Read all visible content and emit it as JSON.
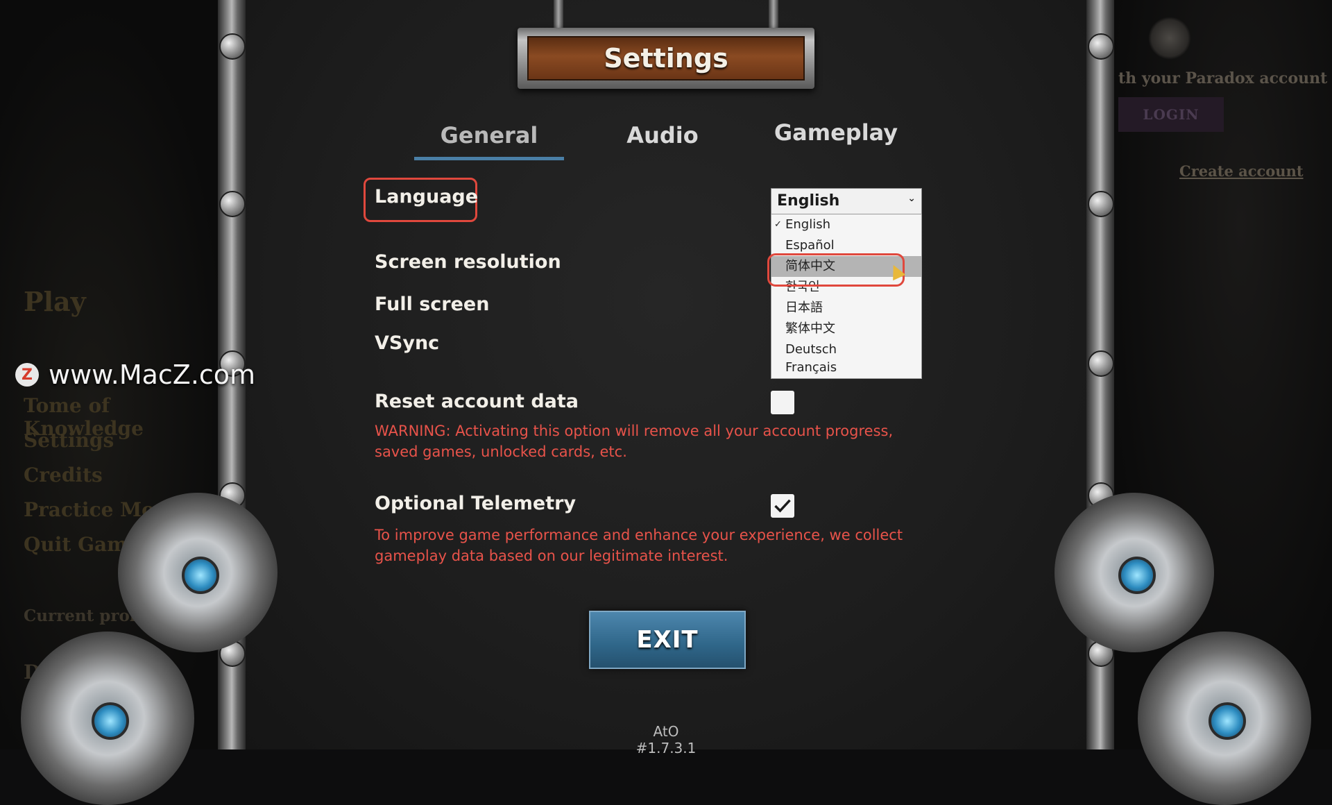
{
  "left_menu": {
    "play": "Play",
    "items": [
      "Tome of Knowledge",
      "Settings",
      "Credits",
      "Practice Mode",
      "Quit Game"
    ],
    "current_profile": "Current profile",
    "dl": "Dl"
  },
  "right_panel": {
    "paradox_text": "th your Paradox account",
    "login": "LOGIN",
    "create_account": "Create account"
  },
  "title": "Settings",
  "tabs": [
    {
      "label": "General",
      "active": true
    },
    {
      "label": "Audio",
      "active": false
    },
    {
      "label": "Gameplay",
      "active": false
    }
  ],
  "settings": {
    "language_label": "Language",
    "screen_resolution_label": "Screen resolution",
    "full_screen_label": "Full screen",
    "vsync_label": "VSync",
    "reset_label": "Reset account data",
    "reset_checked": false,
    "reset_warning": "WARNING: Activating this option will remove all your account progress, saved games, unlocked cards, etc.",
    "telemetry_label": "Optional Telemetry",
    "telemetry_checked": true,
    "telemetry_note": "To improve game performance and enhance your experience, we collect gameplay data based on our legitimate interest."
  },
  "language_dropdown": {
    "selected": "English",
    "options": [
      "English",
      "Español",
      "简体中文",
      "한국인",
      "日本語",
      "繁体中文",
      "Deutsch",
      "Français"
    ],
    "hovered": "简体中文"
  },
  "exit_label": "EXIT",
  "version": "AtO #1.7.3.1",
  "watermark": "www.MacZ.com",
  "colors": {
    "warning": "#e8534a",
    "tab_underline": "#4a7fa6",
    "highlight": "#e0483d",
    "exit_button": "#2f6689"
  }
}
